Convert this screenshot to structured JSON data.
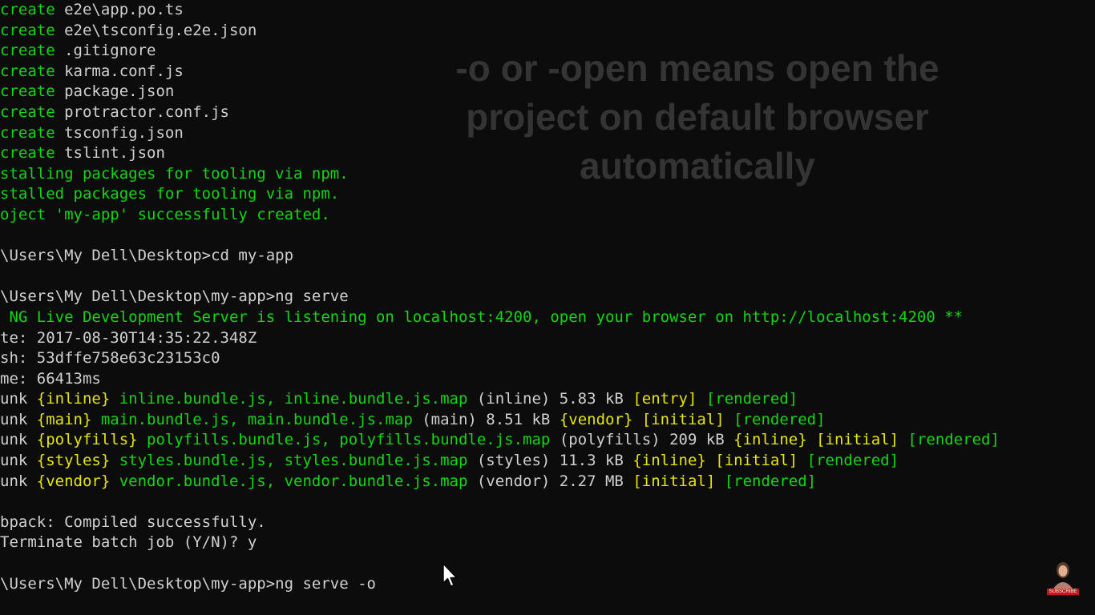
{
  "terminal": {
    "lines": [
      [
        {
          "c": "g",
          "t": "create "
        },
        {
          "c": "w",
          "t": "e2e\\app.po.ts"
        }
      ],
      [
        {
          "c": "g",
          "t": "create "
        },
        {
          "c": "w",
          "t": "e2e\\tsconfig.e2e.json"
        }
      ],
      [
        {
          "c": "g",
          "t": "create "
        },
        {
          "c": "w",
          "t": ".gitignore"
        }
      ],
      [
        {
          "c": "g",
          "t": "create "
        },
        {
          "c": "w",
          "t": "karma.conf.js"
        }
      ],
      [
        {
          "c": "g",
          "t": "create "
        },
        {
          "c": "w",
          "t": "package.json"
        }
      ],
      [
        {
          "c": "g",
          "t": "create "
        },
        {
          "c": "w",
          "t": "protractor.conf.js"
        }
      ],
      [
        {
          "c": "g",
          "t": "create "
        },
        {
          "c": "w",
          "t": "tsconfig.json"
        }
      ],
      [
        {
          "c": "g",
          "t": "create "
        },
        {
          "c": "w",
          "t": "tslint.json"
        }
      ],
      [
        {
          "c": "g",
          "t": "stalling packages for tooling via npm."
        }
      ],
      [
        {
          "c": "g",
          "t": "stalled packages for tooling via npm."
        }
      ],
      [
        {
          "c": "g",
          "t": "oject 'my-app' successfully created."
        }
      ],
      [],
      [
        {
          "c": "w",
          "t": "\\Users\\My Dell\\Desktop>cd my-app"
        }
      ],
      [],
      [
        {
          "c": "w",
          "t": "\\Users\\My Dell\\Desktop\\my-app>ng serve"
        }
      ],
      [
        {
          "c": "g",
          "t": " NG Live Development Server is listening on localhost:4200, open your browser on http://localhost:4200 **"
        }
      ],
      [
        {
          "c": "w",
          "t": "te: 2017-08-30T14:35:22.348Z"
        }
      ],
      [
        {
          "c": "w",
          "t": "sh: 53dffe758e63c23153c0"
        }
      ],
      [
        {
          "c": "w",
          "t": "me: 66413ms"
        }
      ],
      [
        {
          "c": "w",
          "t": "unk "
        },
        {
          "c": "y",
          "t": "{inline} "
        },
        {
          "c": "g",
          "t": "inline.bundle.js, inline.bundle.js.map "
        },
        {
          "c": "w",
          "t": "(inline) 5.83 kB "
        },
        {
          "c": "y",
          "t": "[entry] "
        },
        {
          "c": "g",
          "t": "[rendered]"
        }
      ],
      [
        {
          "c": "w",
          "t": "unk "
        },
        {
          "c": "y",
          "t": "{main} "
        },
        {
          "c": "g",
          "t": "main.bundle.js, main.bundle.js.map "
        },
        {
          "c": "w",
          "t": "(main) 8.51 kB "
        },
        {
          "c": "y",
          "t": "{vendor} [initial] "
        },
        {
          "c": "g",
          "t": "[rendered]"
        }
      ],
      [
        {
          "c": "w",
          "t": "unk "
        },
        {
          "c": "y",
          "t": "{polyfills} "
        },
        {
          "c": "g",
          "t": "polyfills.bundle.js, polyfills.bundle.js.map "
        },
        {
          "c": "w",
          "t": "(polyfills) 209 kB "
        },
        {
          "c": "y",
          "t": "{inline} [initial] "
        },
        {
          "c": "g",
          "t": "[rendered]"
        }
      ],
      [
        {
          "c": "w",
          "t": "unk "
        },
        {
          "c": "y",
          "t": "{styles} "
        },
        {
          "c": "g",
          "t": "styles.bundle.js, styles.bundle.js.map "
        },
        {
          "c": "w",
          "t": "(styles) 11.3 kB "
        },
        {
          "c": "y",
          "t": "{inline} [initial] "
        },
        {
          "c": "g",
          "t": "[rendered]"
        }
      ],
      [
        {
          "c": "w",
          "t": "unk "
        },
        {
          "c": "y",
          "t": "{vendor} "
        },
        {
          "c": "g",
          "t": "vendor.bundle.js, vendor.bundle.js.map "
        },
        {
          "c": "w",
          "t": "(vendor) 2.27 MB "
        },
        {
          "c": "y",
          "t": "[initial] "
        },
        {
          "c": "g",
          "t": "[rendered]"
        }
      ],
      [],
      [
        {
          "c": "w",
          "t": "bpack: Compiled successfully."
        }
      ],
      [
        {
          "c": "w",
          "t": "Terminate batch job (Y/N)? y"
        }
      ],
      [],
      [
        {
          "c": "w",
          "t": "\\Users\\My Dell\\Desktop\\my-app>ng serve -o"
        }
      ]
    ]
  },
  "overlay": {
    "text": "-o or -open means open the\nproject on default browser\nautomatically"
  },
  "colors": {
    "background": "#0c0c0c",
    "green": "#13d613",
    "white": "#d0d0d0",
    "yellow": "#e6e600",
    "overlay_text": "#343434"
  },
  "icons": {
    "cursor": "mouse-pointer-icon",
    "badge": "channel-avatar-icon"
  },
  "badge": {
    "label": "SUBSCRIBE"
  }
}
